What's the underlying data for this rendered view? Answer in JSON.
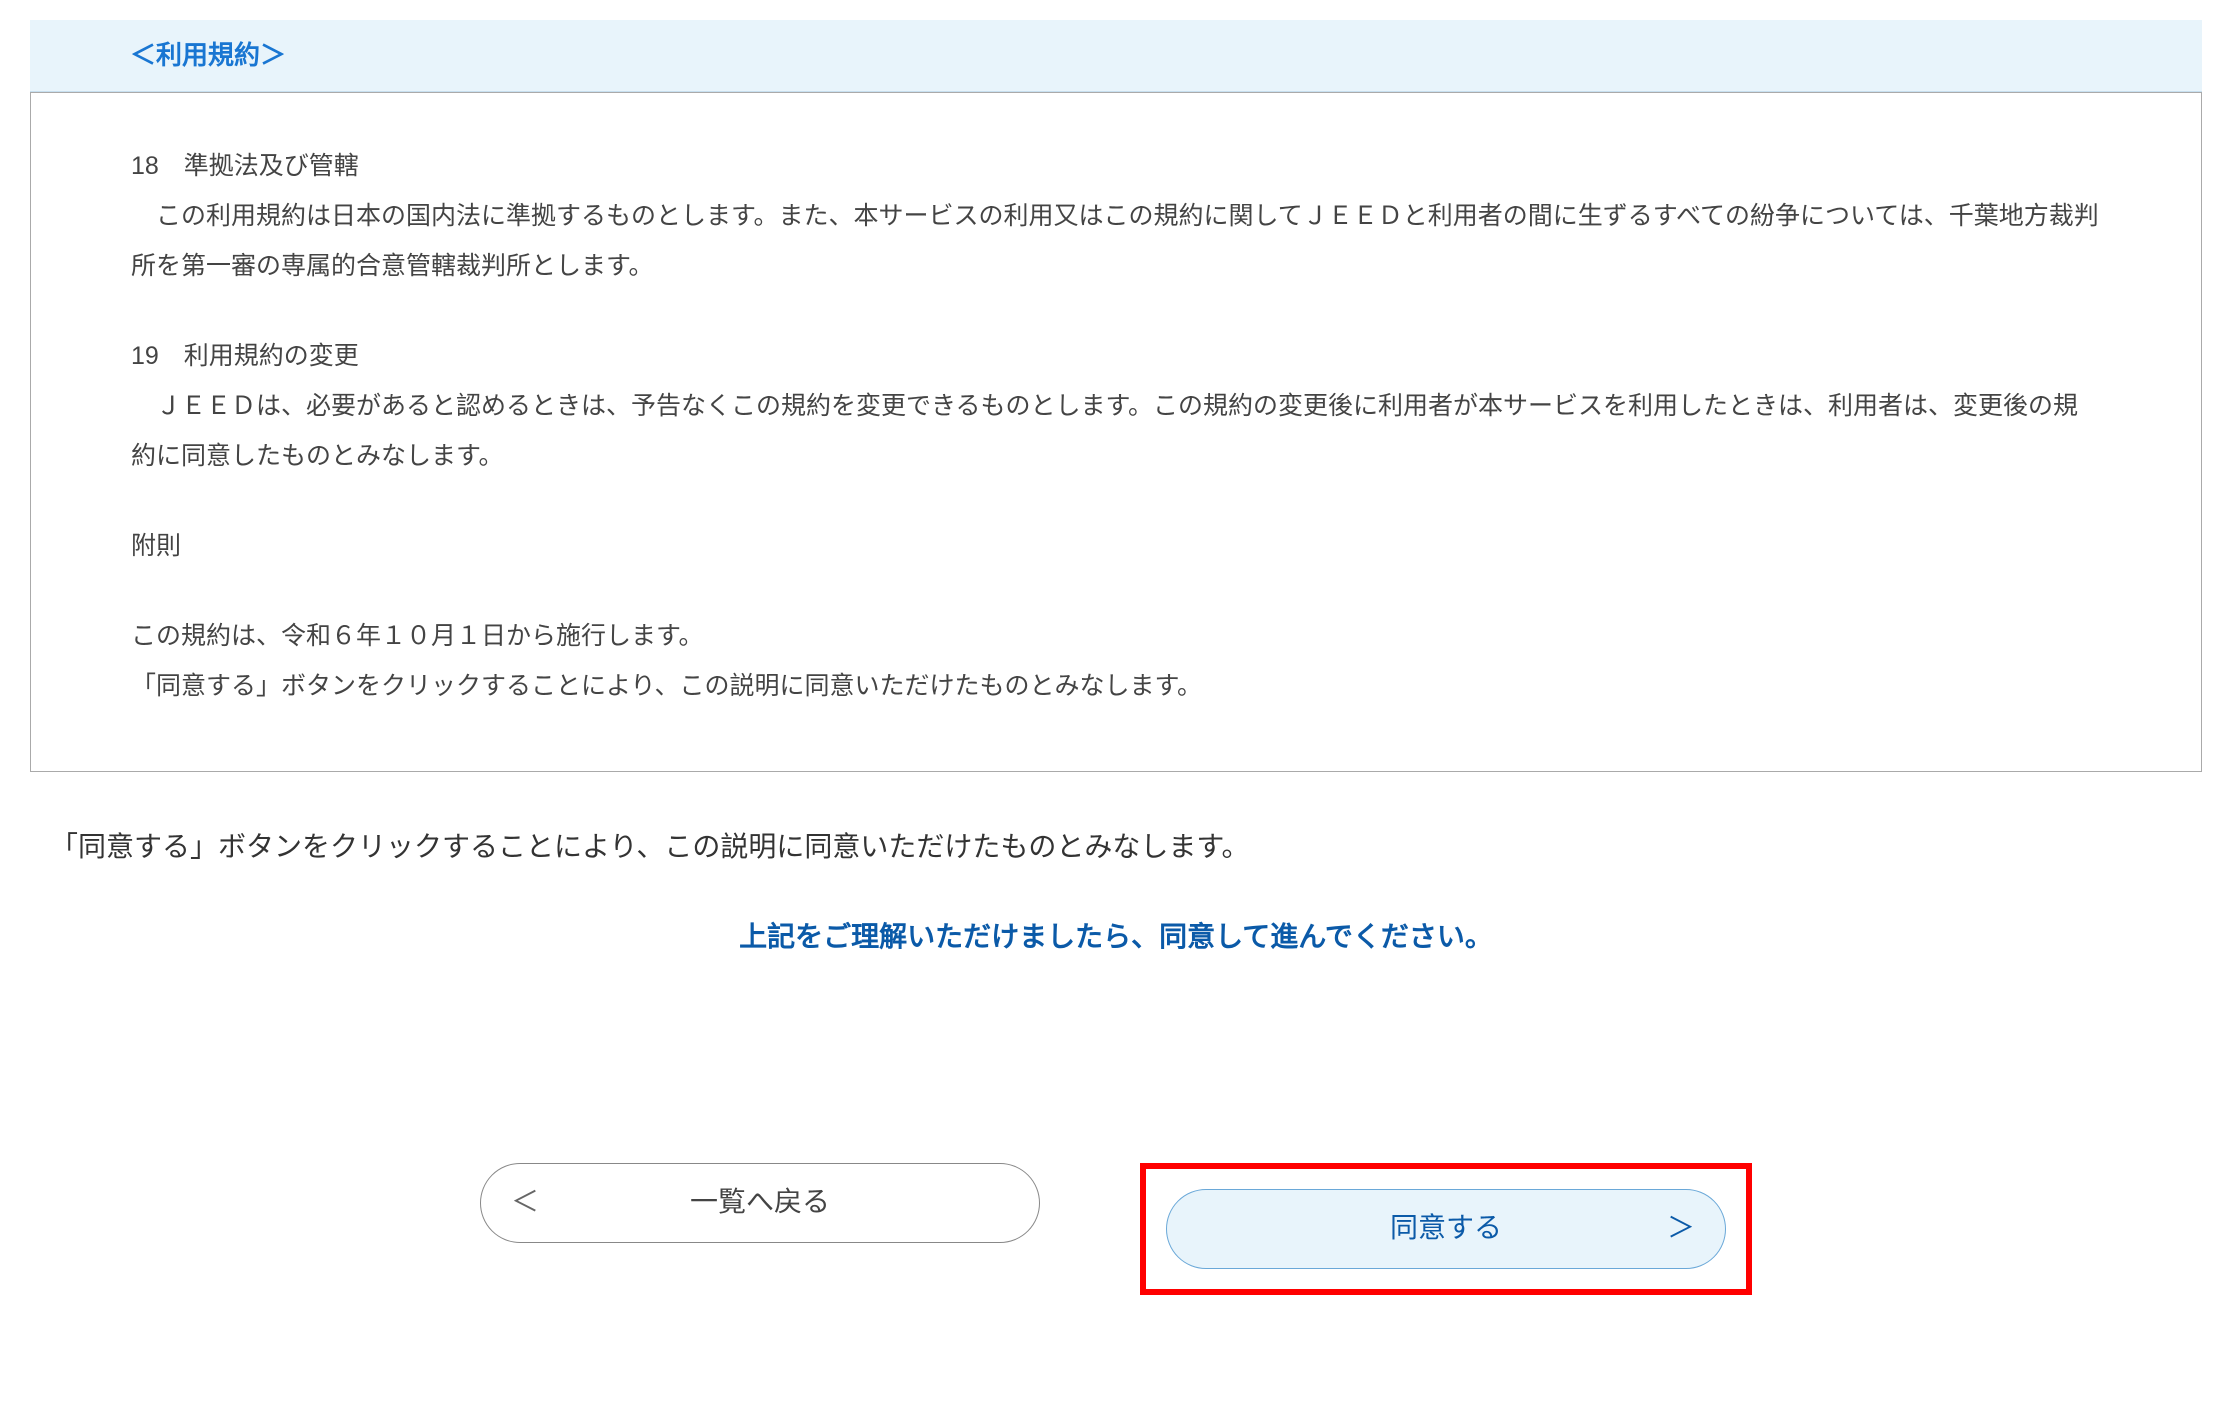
{
  "terms": {
    "header": "＜利用規約＞",
    "section18_title": "18　準拠法及び管轄",
    "section18_body": "　この利用規約は日本の国内法に準拠するものとします。また、本サービスの利用又はこの規約に関してＪＥＥＤと利用者の間に生ずるすべての紛争については、千葉地方裁判所を第一審の専属的合意管轄裁判所とします。",
    "section19_title": "19　利用規約の変更",
    "section19_body": "　ＪＥＥＤは、必要があると認めるときは、予告なくこの規約を変更できるものとします。この規約の変更後に利用者が本サービスを利用したときは、利用者は、変更後の規約に同意したものとみなします。",
    "supplement_title": "附則",
    "supplement_line1": "この規約は、令和６年１０月１日から施行します。",
    "supplement_line2": "「同意する」ボタンをクリックすることにより、この説明に同意いただけたものとみなします。"
  },
  "consent_note": "「同意する」ボタンをクリックすることにより、この説明に同意いただけたものとみなします。",
  "proceed_note": "上記をご理解いただけましたら、同意して進んでください。",
  "buttons": {
    "back": "一覧へ戻る",
    "agree": "同意する"
  },
  "icons": {
    "chevron_left": "＜",
    "chevron_right": "＞"
  }
}
